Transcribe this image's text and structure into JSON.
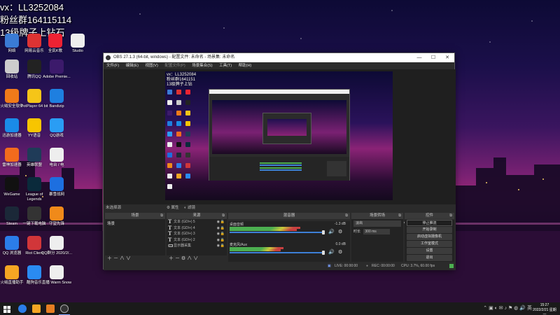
{
  "overlay": {
    "line1": "vx：LL3252084",
    "line2": "粉丝群164115114",
    "line3": "13级牌子上钻石"
  },
  "desktop_icons": [
    {
      "label": "网络",
      "color": "#3a7bd5"
    },
    {
      "label": "网易云音乐",
      "color": "#d33"
    },
    {
      "label": "全民K歌",
      "color": "#e23"
    },
    {
      "label": "Studio",
      "color": "#eee"
    },
    {
      "label": "回收站",
      "color": "#ccc"
    },
    {
      "label": "腾讯QQ",
      "color": "#222"
    },
    {
      "label": "Adobe Premie...",
      "color": "#3c1a6b"
    },
    {
      "label": "火绒安全软件",
      "color": "#f07a1a"
    },
    {
      "label": "PotPlayer 64 bit",
      "color": "#f5c518"
    },
    {
      "label": "Bandizip",
      "color": "#1e7fe0"
    },
    {
      "label": "迅游加速器",
      "color": "#1a8be8"
    },
    {
      "label": "YY语音",
      "color": "#f7c500"
    },
    {
      "label": "QQ游戏",
      "color": "#2a9df4"
    },
    {
      "label": "雷神加速器",
      "color": "#f26b1d"
    },
    {
      "label": "英雄联盟",
      "color": "#1f3b58"
    },
    {
      "label": "电台 / 电",
      "color": "#eee"
    },
    {
      "label": "WeGame",
      "color": "#111"
    },
    {
      "label": "League of Legends",
      "color": "#0a2a3b"
    },
    {
      "label": "暴雪战网",
      "color": "#1d6fe0"
    },
    {
      "label": "Steam",
      "color": "#1b2838"
    },
    {
      "label": "一键下载电脑",
      "color": "#333"
    },
    {
      "label": "守望先锋",
      "color": "#f08a1a"
    },
    {
      "label": "QQ 浏览器",
      "color": "#2b7de9"
    },
    {
      "label": "Riot Client",
      "color": "#d13639"
    },
    {
      "label": "QQ群分 2020/2/...",
      "color": "#eee"
    },
    {
      "label": "火绒直播助手",
      "color": "#f5a623"
    },
    {
      "label": "酷狗音乐",
      "color": "#2a8bf2"
    },
    {
      "label": "直播 Warm Snow",
      "color": "#eee"
    }
  ],
  "obs": {
    "title": "OBS 27.1.3 (64-bit, windows) - 配置文件: 未命名 - 场景集: 未命名",
    "menu": [
      "文件(F)",
      "编辑(E)",
      "视图(V)",
      "配置文件(P)",
      "场景集合(S)",
      "工具(T)",
      "帮助(H)"
    ],
    "preview_overlay": [
      "vx：LL3252084",
      "粉丝群1641151",
      "13级牌子上钻"
    ],
    "dock_bar": {
      "left": "未选择源",
      "tab1": "属性",
      "tab2": "滤镜"
    },
    "scenes": {
      "title": "场景",
      "items": [
        "场景"
      ]
    },
    "sources": {
      "title": "来源",
      "items": [
        "文本 (GDI+) 5",
        "文本 (GDI+) 4",
        "文本 (GDI+) 3",
        "文本 (GDI+) 2",
        "显示器采集"
      ]
    },
    "mixer": {
      "title": "混音器",
      "channels": [
        {
          "name": "桌面音频",
          "db": "-1.3 dB",
          "level": 0.72
        },
        {
          "name": "麦克风/Aux",
          "db": "0.0 dB",
          "level": 0.55
        }
      ]
    },
    "transitions": {
      "title": "场景转场",
      "type": "淡出",
      "duration_label": "时长",
      "duration": "300 ms"
    },
    "controls": {
      "title": "控件",
      "buttons": [
        "停止推流",
        "开始录制",
        "启动虚拟摄像机",
        "工作室模式",
        "设置",
        "退出"
      ]
    },
    "status": {
      "live": "LIVE: 00:00:00",
      "rec": "REC: 00:00:00",
      "cpu": "CPU: 3.7%, 60.00 fps"
    }
  },
  "taskbar": {
    "time": "15:27",
    "date": "2022/2/21 星期一"
  }
}
